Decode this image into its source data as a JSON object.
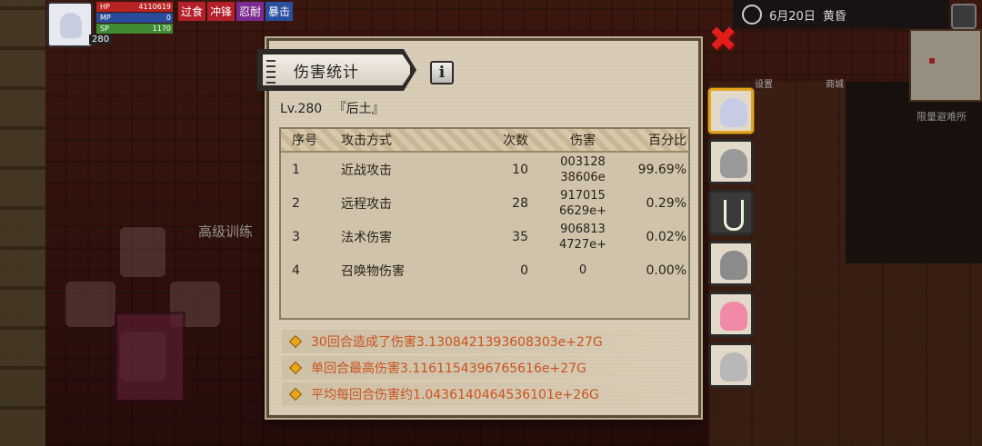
{
  "hud": {
    "hp_label": "HP",
    "hp_value": "4110619",
    "mp_label": "MP",
    "mp_value": "0",
    "sp_label": "SP",
    "sp_value": "1170",
    "level": "280",
    "status_tags": [
      "过食",
      "冲锋",
      "忍耐",
      "暴击"
    ]
  },
  "topbar": {
    "date": "6月20日",
    "time_of_day": "黄昏"
  },
  "scene": {
    "side_label": "限量避难所",
    "training_label": "高级训练",
    "menu_labels": [
      "设置",
      "商城"
    ]
  },
  "dialog": {
    "title": "伤害统计",
    "info_icon": "i",
    "level_text": "Lv.280",
    "title_text": "『后土』",
    "columns": [
      "序号",
      "攻击方式",
      "次数",
      "伤害",
      "百分比"
    ],
    "rows": [
      {
        "idx": "1",
        "type": "近战攻击",
        "count": "10",
        "damage_l1": "003128",
        "damage_l2": "38606e",
        "pct": "99.69%"
      },
      {
        "idx": "2",
        "type": "远程攻击",
        "count": "28",
        "damage_l1": "917015",
        "damage_l2": "6629e+",
        "pct": "0.29%"
      },
      {
        "idx": "3",
        "type": "法术伤害",
        "count": "35",
        "damage_l1": "906813",
        "damage_l2": "4727e+",
        "pct": "0.02%"
      },
      {
        "idx": "4",
        "type": "召唤物伤害",
        "count": "0",
        "damage_l1": "0",
        "damage_l2": "",
        "pct": "0.00%"
      }
    ],
    "summaries": [
      "30回合造成了伤害3.1308421393608303e+27G",
      "单回合最高伤害3.1161154396765616e+27G",
      "平均每回合伤害约1.0436140464536101e+26G"
    ]
  },
  "close_icon": "✖",
  "side_tabs": [
    "character-1",
    "character-2",
    "character-3",
    "character-4",
    "character-5",
    "character-6"
  ],
  "colors": {
    "summary_text": "#c9541f",
    "close": "#e31c1c",
    "active_tab": "#e3a51f"
  }
}
